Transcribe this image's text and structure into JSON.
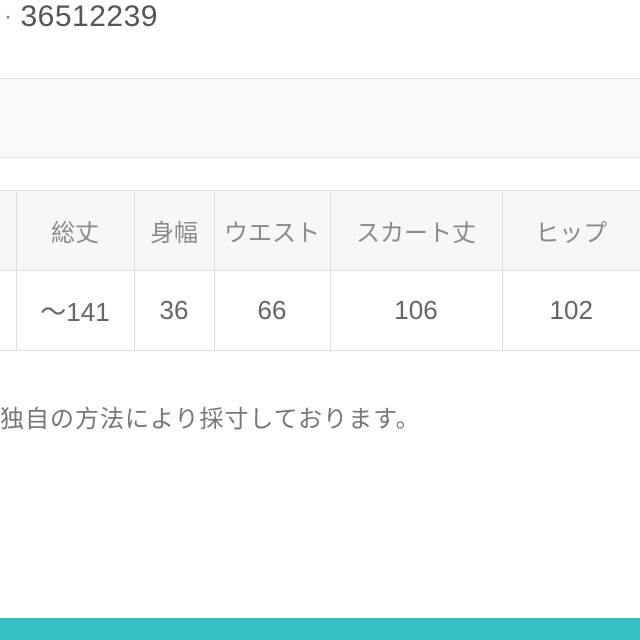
{
  "product": {
    "bullet_prefix": "·",
    "code": "36512239"
  },
  "size_table": {
    "headers": [
      "",
      "総丈",
      "身幅",
      "ウエスト",
      "スカート丈",
      "ヒップ"
    ],
    "row": [
      "",
      "〜141",
      "36",
      "66",
      "106",
      "102"
    ]
  },
  "note_text": "独自の方法により採寸しております。"
}
